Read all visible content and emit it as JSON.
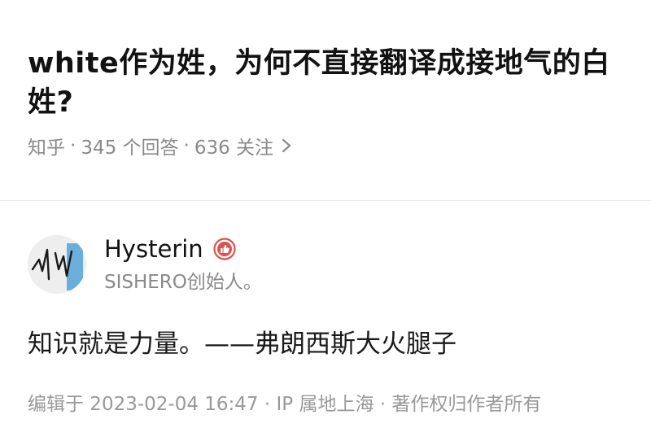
{
  "question": {
    "title": "white作为姓，为何不直接翻译成接地气的白姓?",
    "meta": {
      "source": "知乎",
      "answers": "345 个回答",
      "followers": "636 关注",
      "separator": "·"
    }
  },
  "answer": {
    "author": {
      "name": "Hysterin",
      "bio": "SISHERO创始人。",
      "badge_icon": "thumbs-up-badge-icon"
    },
    "content": "知识就是力量。——弗朗西斯大火腿子",
    "footer": "编辑于 2023-02-04 16:47 · IP 属地上海 · 著作权归作者所有"
  },
  "colors": {
    "title": "#121212",
    "meta": "#8a8a8a",
    "badge": "#d9534f",
    "divider": "#e8e8e8",
    "avatar_accent": "#6aaedb"
  }
}
